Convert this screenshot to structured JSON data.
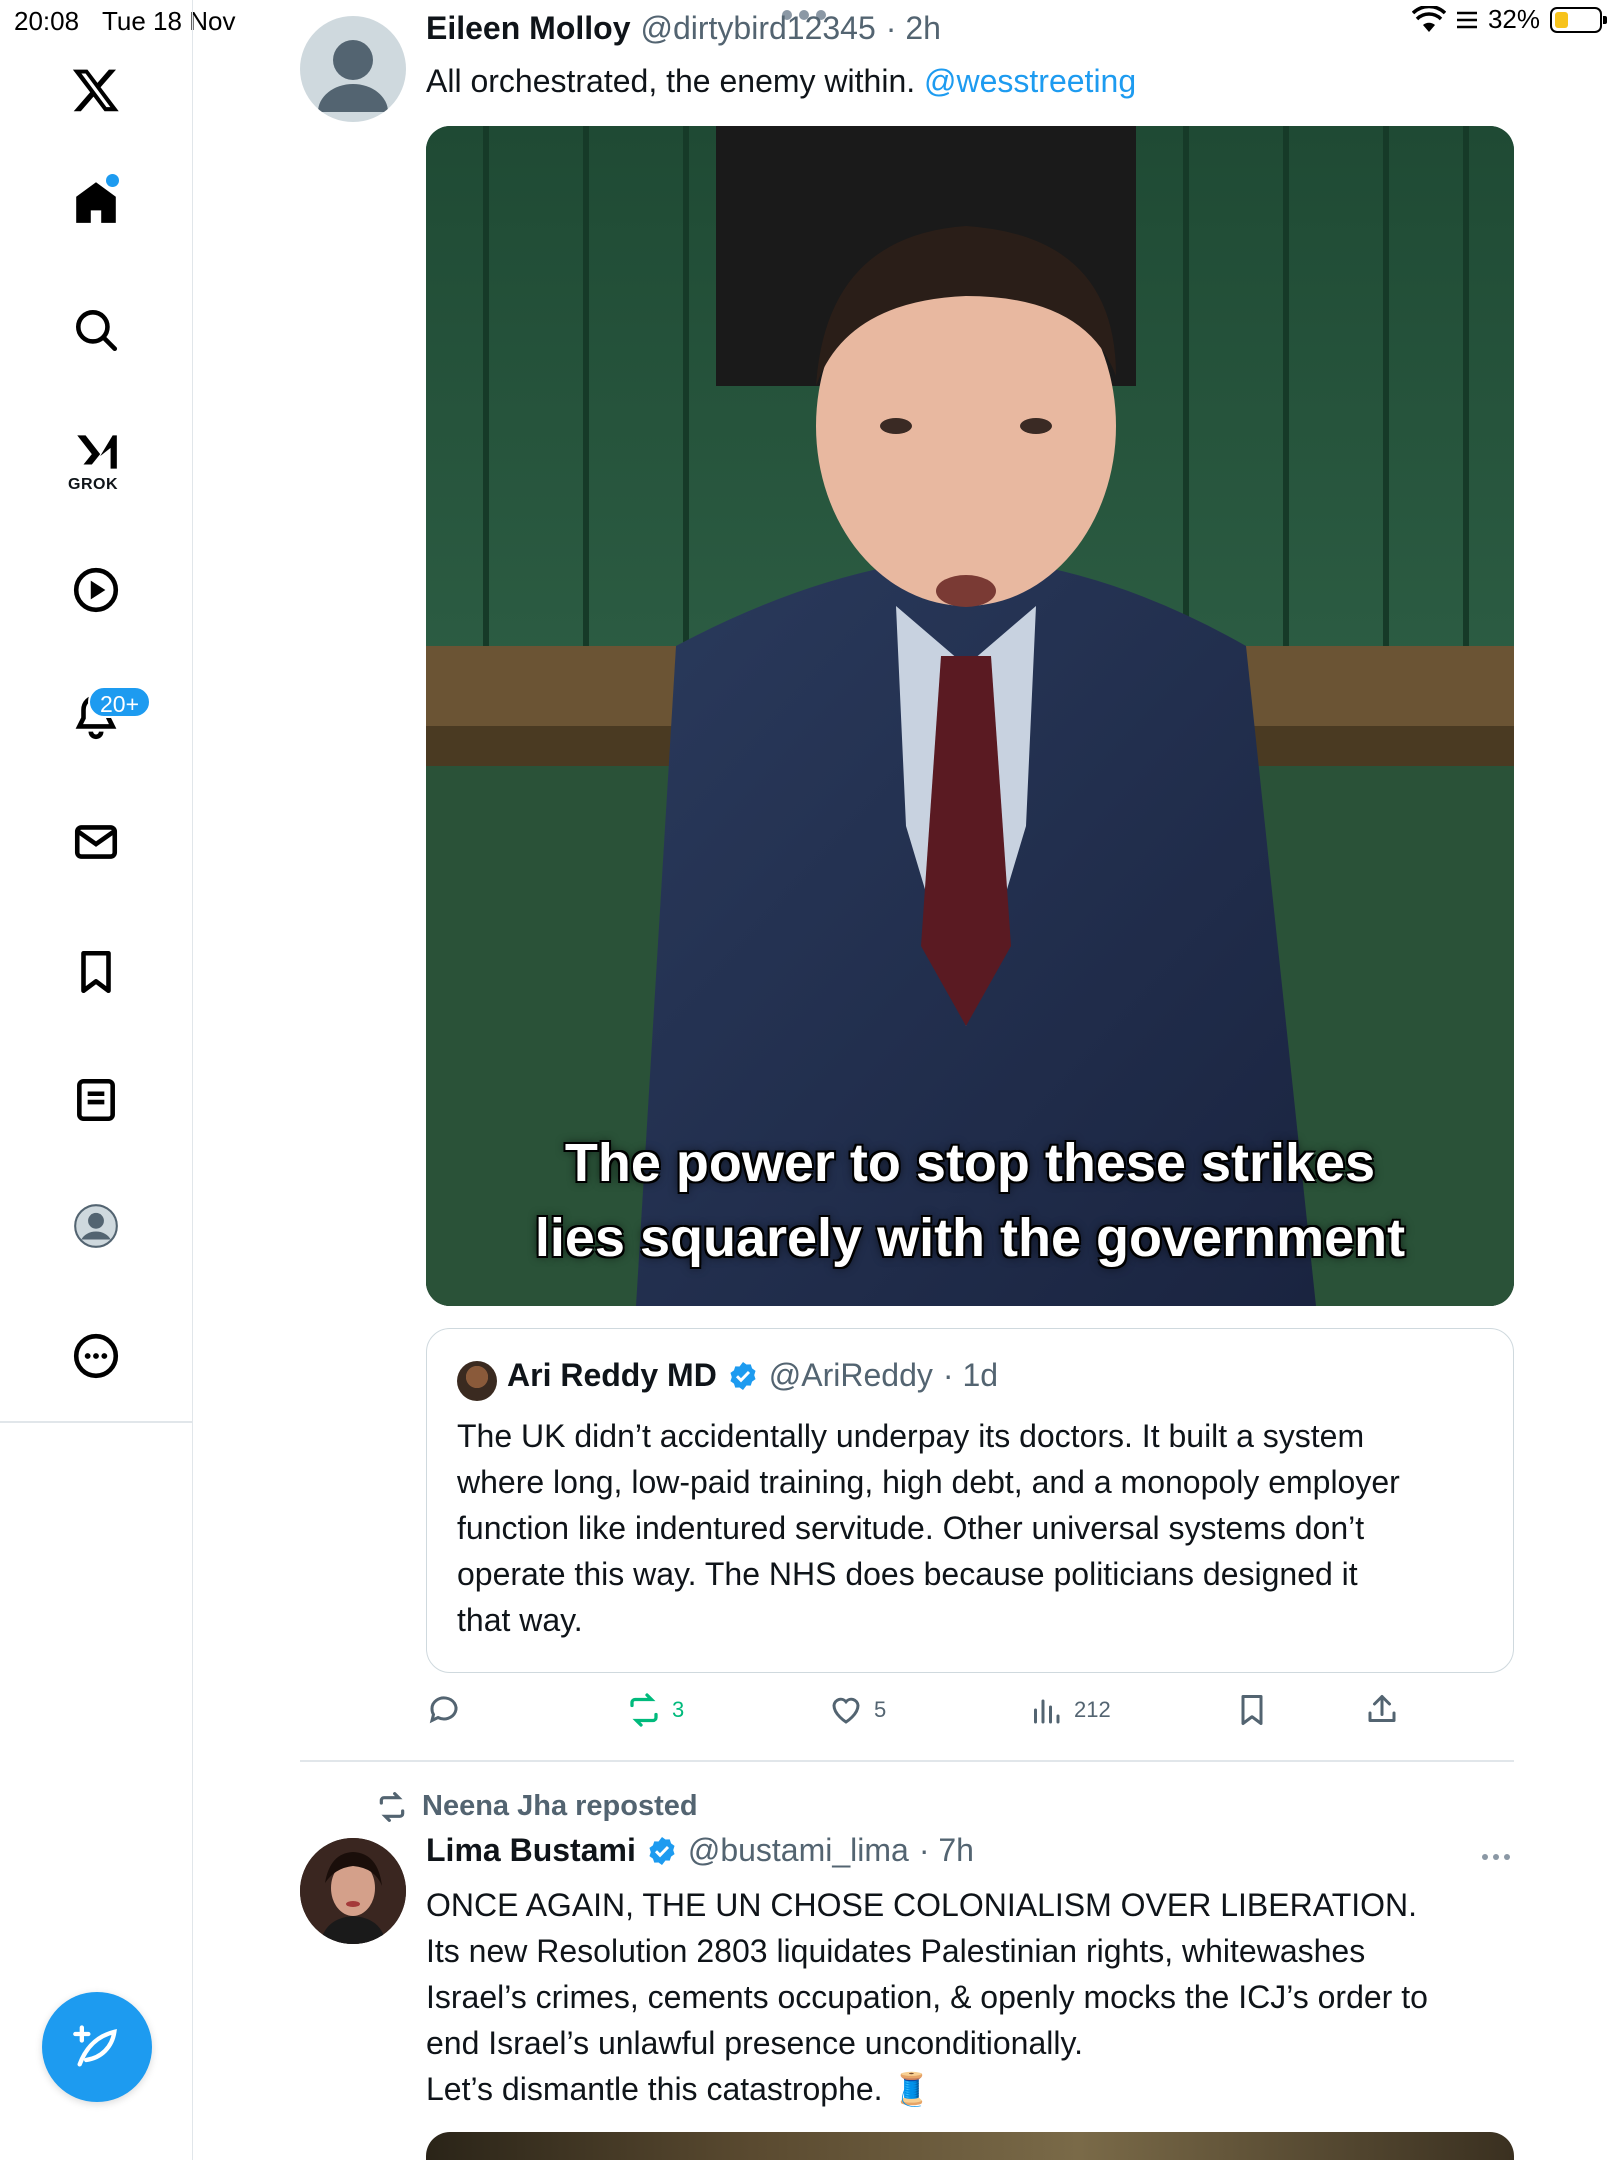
{
  "status_bar": {
    "time": "20:08",
    "date": "Tue 18 Nov",
    "battery": "32%",
    "battery_level": 0.32
  },
  "sidebar": {
    "items": [
      {
        "name": "home",
        "icon": "home-icon"
      },
      {
        "name": "search",
        "icon": "search-icon"
      },
      {
        "name": "grok",
        "icon": "grok-icon",
        "label": "GROK"
      },
      {
        "name": "video",
        "icon": "play-icon"
      },
      {
        "name": "notifications",
        "icon": "bell-icon",
        "badge": "20+"
      },
      {
        "name": "messages",
        "icon": "mail-icon"
      },
      {
        "name": "bookmarks",
        "icon": "bookmark-icon"
      },
      {
        "name": "lists",
        "icon": "list-icon"
      },
      {
        "name": "profile",
        "icon": "profile-icon"
      },
      {
        "name": "more",
        "icon": "more-icon"
      }
    ],
    "compose_icon": "compose-icon"
  },
  "tweets": [
    {
      "author": "Eileen Molloy",
      "handle": "@dirtybird12345",
      "time": "· 2h",
      "text": "All orchestrated, the enemy within.",
      "mention": "@wesstreeting",
      "media_caption_line1": "The power to stop these strikes",
      "media_caption_line2": "lies squarely with the government",
      "quote": {
        "author": "Ari Reddy MD",
        "handle": "@AriReddy",
        "time": "· 1d",
        "lines": [
          "The UK didn’t accidentally underpay its doctors. It built a system",
          "where long, low-paid training, high debt, and a monopoly employer",
          "function like indentured servitude. Other universal systems don’t",
          "operate this way. The NHS does because politicians designed it",
          "that way."
        ]
      },
      "actions": {
        "replies": "",
        "reposts": "3",
        "likes": "5",
        "views": "212"
      }
    },
    {
      "reposted_by": "Neena Jha reposted",
      "author": "Lima Bustami",
      "handle": "@bustami_lima",
      "time": "· 7h",
      "lines": [
        "ONCE AGAIN, THE UN CHOSE COLONIALISM OVER LIBERATION.",
        "Its new Resolution 2803 liquidates Palestinian rights, whitewashes",
        "Israel’s crimes, cements occupation, & openly mocks the ICJ’s order to",
        "end Israel’s unlawful presence unconditionally.",
        "Let’s dismantle this catastrophe. 🧵"
      ]
    }
  ],
  "colors": {
    "accent": "#1d9bf0",
    "repost_green": "#00ba7c",
    "secondary_text": "#536471"
  }
}
